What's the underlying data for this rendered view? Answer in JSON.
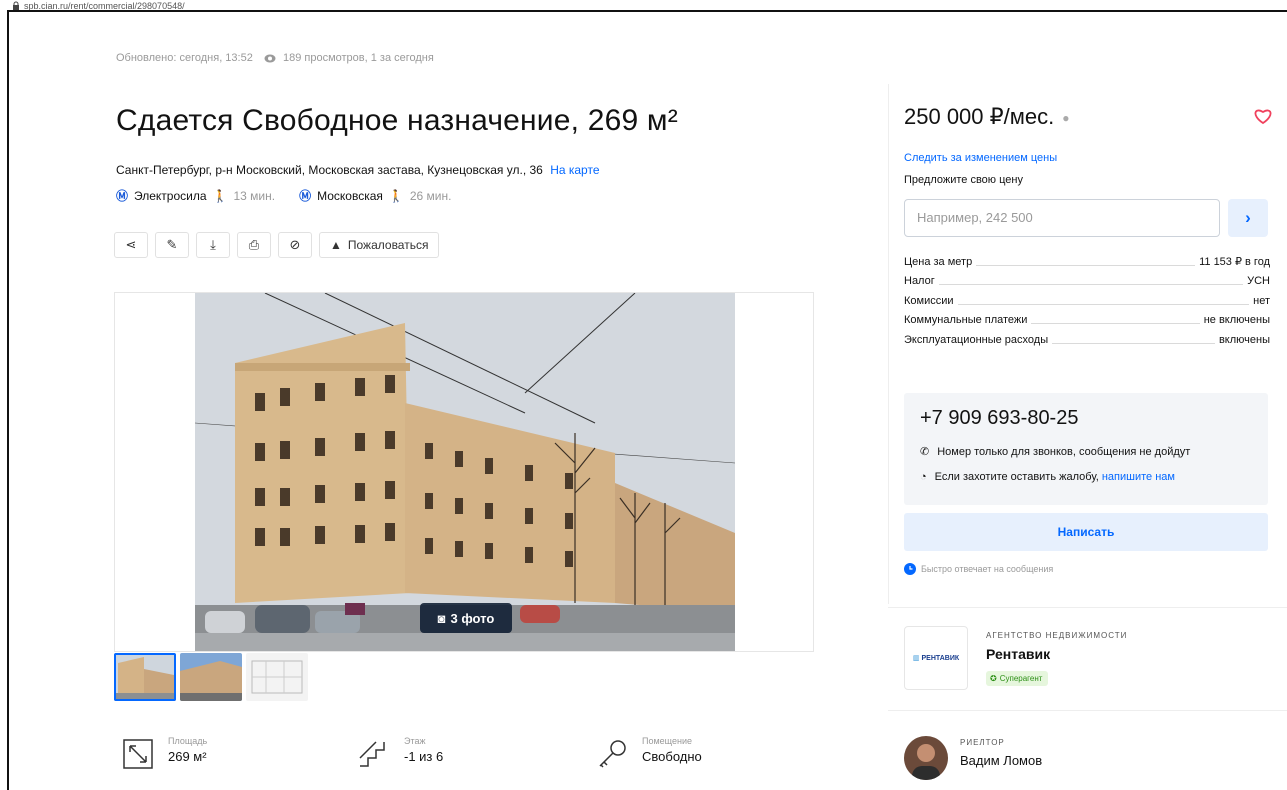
{
  "browser": {
    "url": "spb.cian.ru/rent/commercial/298070548/"
  },
  "meta": {
    "updated": "Обновлено: сегодня, 13:52",
    "views": "189 просмотров, 1 за сегодня"
  },
  "listing": {
    "title": "Сдается Свободное назначение, 269 м²",
    "address": "Санкт-Петербург, р-н Московский, Московская застава, Кузнецовская ул., 36",
    "map_link": "На карте",
    "metro": [
      {
        "icon": "metro-icon",
        "name": "Электросила",
        "time": "13 мин."
      },
      {
        "icon": "metro-icon",
        "name": "Московская",
        "time": "26 мин."
      }
    ]
  },
  "toolbar": {
    "report_label": "Пожаловаться"
  },
  "gallery": {
    "photo_count": "3 фото"
  },
  "features": [
    {
      "icon": "area-icon",
      "label": "Площадь",
      "value": "269 м²"
    },
    {
      "icon": "stairs-icon",
      "label": "Этаж",
      "value": "-1 из 6"
    },
    {
      "icon": "key-icon",
      "label": "Помещение",
      "value": "Свободно"
    }
  ],
  "sidebar": {
    "price": "250 000 ₽/мес.",
    "watch_price": "Следить за изменением цены",
    "offer_label": "Предложите свою цену",
    "offer_placeholder": "Например, 242 500",
    "params": [
      {
        "k": "Цена за метр",
        "v": "11 153 ₽ в год"
      },
      {
        "k": "Налог",
        "v": "УСН"
      },
      {
        "k": "Комиссии",
        "v": "нет"
      },
      {
        "k": "Коммунальные платежи",
        "v": "не включены"
      },
      {
        "k": "Эксплуатационные расходы",
        "v": "включены"
      }
    ],
    "phone": "+7 909 693-80-25",
    "phone_note": "Номер только для звонков, сообщения не дойдут",
    "complaint_text": "Если захотите оставить жалобу,",
    "complaint_link": "напишите нам",
    "write_button": "Написать",
    "fast_reply": "Быстро отвечает на сообщения",
    "agency_type": "АГЕНТСТВО НЕДВИЖИМОСТИ",
    "agency_name": "Рентавик",
    "agency_logo_text": "РЕНТАВИК",
    "agency_badge": "Суперагент",
    "realtor_type": "РИЕЛТОР",
    "realtor_name": "Вадим Ломов"
  },
  "colors": {
    "accent": "#0468ff",
    "heart": "#f0415d",
    "super": "#2c8f16"
  }
}
